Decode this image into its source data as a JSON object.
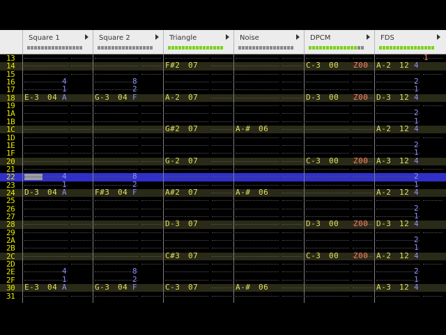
{
  "channels": [
    {
      "name": "Square 1",
      "meter_on": 0
    },
    {
      "name": "Square 2",
      "meter_on": 0
    },
    {
      "name": "Triangle",
      "meter_on": 16
    },
    {
      "name": "Noise",
      "meter_on": 0
    },
    {
      "name": "DPCM",
      "meter_on": 14
    },
    {
      "name": "FDS",
      "meter_on": 16
    }
  ],
  "rows": [
    {
      "n": "13",
      "cells": [
        [
          "",
          "",
          "",
          ""
        ],
        [
          "",
          "",
          "",
          ""
        ],
        [
          "",
          "",
          "",
          ""
        ],
        [
          "",
          "",
          "",
          ""
        ],
        [
          "",
          "",
          "",
          ""
        ],
        [
          "",
          "",
          "",
          "1"
        ]
      ]
    },
    {
      "n": "14",
      "hl": true,
      "cells": [
        [
          "",
          "",
          "",
          ""
        ],
        [
          "",
          "",
          "",
          ""
        ],
        [
          "F#2",
          "07",
          "",
          ""
        ],
        [
          "",
          "",
          "",
          ""
        ],
        [
          "C-3",
          "00",
          "",
          "Z00"
        ],
        [
          "A-2",
          "12",
          "4",
          ""
        ]
      ]
    },
    {
      "n": "15",
      "cells": [
        [
          "",
          "",
          "",
          ""
        ],
        [
          "",
          "",
          "",
          ""
        ],
        [
          "",
          "",
          "",
          ""
        ],
        [
          "",
          "",
          "",
          ""
        ],
        [
          "",
          "",
          "",
          ""
        ],
        [
          "",
          "",
          "",
          ""
        ]
      ]
    },
    {
      "n": "16",
      "cells": [
        [
          "",
          "",
          "4",
          ""
        ],
        [
          "",
          "",
          "8",
          ""
        ],
        [
          "",
          "",
          "",
          ""
        ],
        [
          "",
          "",
          "",
          ""
        ],
        [
          "",
          "",
          "",
          ""
        ],
        [
          "",
          "",
          "2",
          ""
        ]
      ]
    },
    {
      "n": "17",
      "cells": [
        [
          "",
          "",
          "1",
          ""
        ],
        [
          "",
          "",
          "2",
          ""
        ],
        [
          "",
          "",
          "",
          ""
        ],
        [
          "",
          "",
          "",
          ""
        ],
        [
          "",
          "",
          "",
          ""
        ],
        [
          "",
          "",
          "1",
          ""
        ]
      ]
    },
    {
      "n": "18",
      "hl": true,
      "cells": [
        [
          "E-3",
          "04",
          "A",
          ""
        ],
        [
          "G-3",
          "04",
          "F",
          ""
        ],
        [
          "A-2",
          "07",
          "",
          ""
        ],
        [
          "",
          "",
          "",
          ""
        ],
        [
          "D-3",
          "00",
          "",
          "Z00"
        ],
        [
          "D-3",
          "12",
          "4",
          ""
        ]
      ]
    },
    {
      "n": "19",
      "cells": [
        [
          "",
          "",
          "",
          ""
        ],
        [
          "",
          "",
          "",
          ""
        ],
        [
          "",
          "",
          "",
          ""
        ],
        [
          "",
          "",
          "",
          ""
        ],
        [
          "",
          "",
          "",
          ""
        ],
        [
          "",
          "",
          "",
          ""
        ]
      ]
    },
    {
      "n": "1A",
      "cells": [
        [
          "",
          "",
          "",
          ""
        ],
        [
          "",
          "",
          "",
          ""
        ],
        [
          "",
          "",
          "",
          ""
        ],
        [
          "",
          "",
          "",
          ""
        ],
        [
          "",
          "",
          "",
          ""
        ],
        [
          "",
          "",
          "2",
          ""
        ]
      ]
    },
    {
      "n": "1B",
      "cells": [
        [
          "",
          "",
          "",
          ""
        ],
        [
          "",
          "",
          "",
          ""
        ],
        [
          "",
          "",
          "",
          ""
        ],
        [
          "",
          "",
          "",
          ""
        ],
        [
          "",
          "",
          "",
          ""
        ],
        [
          "",
          "",
          "1",
          ""
        ]
      ]
    },
    {
      "n": "1C",
      "hl": true,
      "cells": [
        [
          "",
          "",
          "",
          ""
        ],
        [
          "",
          "",
          "",
          ""
        ],
        [
          "G#2",
          "07",
          "",
          ""
        ],
        [
          "A-#",
          "06",
          "",
          ""
        ],
        [
          "",
          "",
          "",
          ""
        ],
        [
          "A-2",
          "12",
          "4",
          ""
        ]
      ]
    },
    {
      "n": "1D",
      "cells": [
        [
          "",
          "",
          "",
          ""
        ],
        [
          "",
          "",
          "",
          ""
        ],
        [
          "",
          "",
          "",
          ""
        ],
        [
          "",
          "",
          "",
          ""
        ],
        [
          "",
          "",
          "",
          ""
        ],
        [
          "",
          "",
          "",
          ""
        ]
      ]
    },
    {
      "n": "1E",
      "cells": [
        [
          "",
          "",
          "",
          ""
        ],
        [
          "",
          "",
          "",
          ""
        ],
        [
          "",
          "",
          "",
          ""
        ],
        [
          "",
          "",
          "",
          ""
        ],
        [
          "",
          "",
          "",
          ""
        ],
        [
          "",
          "",
          "2",
          ""
        ]
      ]
    },
    {
      "n": "1F",
      "cells": [
        [
          "",
          "",
          "",
          ""
        ],
        [
          "",
          "",
          "",
          ""
        ],
        [
          "",
          "",
          "",
          ""
        ],
        [
          "",
          "",
          "",
          ""
        ],
        [
          "",
          "",
          "",
          ""
        ],
        [
          "",
          "",
          "1",
          ""
        ]
      ]
    },
    {
      "n": "20",
      "hl": true,
      "cells": [
        [
          "",
          "",
          "",
          ""
        ],
        [
          "",
          "",
          "",
          ""
        ],
        [
          "G-2",
          "07",
          "",
          ""
        ],
        [
          "",
          "",
          "",
          ""
        ],
        [
          "C-3",
          "00",
          "",
          "Z00"
        ],
        [
          "A-3",
          "12",
          "4",
          ""
        ]
      ]
    },
    {
      "n": "21",
      "cells": [
        [
          "",
          "",
          "",
          ""
        ],
        [
          "",
          "",
          "",
          ""
        ],
        [
          "",
          "",
          "",
          ""
        ],
        [
          "",
          "",
          "",
          ""
        ],
        [
          "",
          "",
          "",
          ""
        ],
        [
          "",
          "",
          "",
          ""
        ]
      ]
    },
    {
      "n": "22",
      "cur": true,
      "cells": [
        [
          "",
          "",
          "4",
          ""
        ],
        [
          "",
          "",
          "8",
          ""
        ],
        [
          "",
          "",
          "",
          ""
        ],
        [
          "",
          "",
          "",
          ""
        ],
        [
          "",
          "",
          "",
          ""
        ],
        [
          "",
          "",
          "2",
          ""
        ]
      ]
    },
    {
      "n": "23",
      "cells": [
        [
          "",
          "",
          "1",
          ""
        ],
        [
          "",
          "",
          "2",
          ""
        ],
        [
          "",
          "",
          "",
          ""
        ],
        [
          "",
          "",
          "",
          ""
        ],
        [
          "",
          "",
          "",
          ""
        ],
        [
          "",
          "",
          "1",
          ""
        ]
      ]
    },
    {
      "n": "24",
      "hl": true,
      "cells": [
        [
          "D-3",
          "04",
          "A",
          ""
        ],
        [
          "F#3",
          "04",
          "F",
          ""
        ],
        [
          "A#2",
          "07",
          "",
          ""
        ],
        [
          "A-#",
          "06",
          "",
          ""
        ],
        [
          "",
          "",
          "",
          ""
        ],
        [
          "A-2",
          "12",
          "4",
          ""
        ]
      ]
    },
    {
      "n": "25",
      "cells": [
        [
          "",
          "",
          "",
          ""
        ],
        [
          "",
          "",
          "",
          ""
        ],
        [
          "",
          "",
          "",
          ""
        ],
        [
          "",
          "",
          "",
          ""
        ],
        [
          "",
          "",
          "",
          ""
        ],
        [
          "",
          "",
          "",
          ""
        ]
      ]
    },
    {
      "n": "26",
      "cells": [
        [
          "",
          "",
          "",
          ""
        ],
        [
          "",
          "",
          "",
          ""
        ],
        [
          "",
          "",
          "",
          ""
        ],
        [
          "",
          "",
          "",
          ""
        ],
        [
          "",
          "",
          "",
          ""
        ],
        [
          "",
          "",
          "2",
          ""
        ]
      ]
    },
    {
      "n": "27",
      "cells": [
        [
          "",
          "",
          "",
          ""
        ],
        [
          "",
          "",
          "",
          ""
        ],
        [
          "",
          "",
          "",
          ""
        ],
        [
          "",
          "",
          "",
          ""
        ],
        [
          "",
          "",
          "",
          ""
        ],
        [
          "",
          "",
          "1",
          ""
        ]
      ]
    },
    {
      "n": "28",
      "hl": true,
      "cells": [
        [
          "",
          "",
          "",
          ""
        ],
        [
          "",
          "",
          "",
          ""
        ],
        [
          "D-3",
          "07",
          "",
          ""
        ],
        [
          "",
          "",
          "",
          ""
        ],
        [
          "D-3",
          "00",
          "",
          "Z00"
        ],
        [
          "D-3",
          "12",
          "4",
          ""
        ]
      ]
    },
    {
      "n": "29",
      "cells": [
        [
          "",
          "",
          "",
          ""
        ],
        [
          "",
          "",
          "",
          ""
        ],
        [
          "",
          "",
          "",
          ""
        ],
        [
          "",
          "",
          "",
          ""
        ],
        [
          "",
          "",
          "",
          ""
        ],
        [
          "",
          "",
          "",
          ""
        ]
      ]
    },
    {
      "n": "2A",
      "cells": [
        [
          "",
          "",
          "",
          ""
        ],
        [
          "",
          "",
          "",
          ""
        ],
        [
          "",
          "",
          "",
          ""
        ],
        [
          "",
          "",
          "",
          ""
        ],
        [
          "",
          "",
          "",
          ""
        ],
        [
          "",
          "",
          "2",
          ""
        ]
      ]
    },
    {
      "n": "2B",
      "cells": [
        [
          "",
          "",
          "",
          ""
        ],
        [
          "",
          "",
          "",
          ""
        ],
        [
          "",
          "",
          "",
          ""
        ],
        [
          "",
          "",
          "",
          ""
        ],
        [
          "",
          "",
          "",
          ""
        ],
        [
          "",
          "",
          "1",
          ""
        ]
      ]
    },
    {
      "n": "2C",
      "hl": true,
      "cells": [
        [
          "",
          "",
          "",
          ""
        ],
        [
          "",
          "",
          "",
          ""
        ],
        [
          "C#3",
          "07",
          "",
          ""
        ],
        [
          "",
          "",
          "",
          ""
        ],
        [
          "C-3",
          "00",
          "",
          "Z00"
        ],
        [
          "A-2",
          "12",
          "4",
          ""
        ]
      ]
    },
    {
      "n": "2D",
      "cells": [
        [
          "",
          "",
          "",
          ""
        ],
        [
          "",
          "",
          "",
          ""
        ],
        [
          "",
          "",
          "",
          ""
        ],
        [
          "",
          "",
          "",
          ""
        ],
        [
          "",
          "",
          "",
          ""
        ],
        [
          "",
          "",
          "",
          ""
        ]
      ]
    },
    {
      "n": "2E",
      "cells": [
        [
          "",
          "",
          "4",
          ""
        ],
        [
          "",
          "",
          "8",
          ""
        ],
        [
          "",
          "",
          "",
          ""
        ],
        [
          "",
          "",
          "",
          ""
        ],
        [
          "",
          "",
          "",
          ""
        ],
        [
          "",
          "",
          "2",
          ""
        ]
      ]
    },
    {
      "n": "2F",
      "cells": [
        [
          "",
          "",
          "1",
          ""
        ],
        [
          "",
          "",
          "2",
          ""
        ],
        [
          "",
          "",
          "",
          ""
        ],
        [
          "",
          "",
          "",
          ""
        ],
        [
          "",
          "",
          "",
          ""
        ],
        [
          "",
          "",
          "1",
          ""
        ]
      ]
    },
    {
      "n": "30",
      "hl": true,
      "cells": [
        [
          "E-3",
          "04",
          "A",
          ""
        ],
        [
          "G-3",
          "04",
          "F",
          ""
        ],
        [
          "C-3",
          "07",
          "",
          ""
        ],
        [
          "A-#",
          "06",
          "",
          ""
        ],
        [
          "",
          "",
          "",
          ""
        ],
        [
          "A-3",
          "12",
          "4",
          ""
        ]
      ]
    },
    {
      "n": "31",
      "cells": [
        [
          "",
          "",
          "",
          ""
        ],
        [
          "",
          "",
          "",
          ""
        ],
        [
          "",
          "",
          "",
          ""
        ],
        [
          "",
          "",
          "",
          ""
        ],
        [
          "",
          "",
          "",
          ""
        ],
        [
          "",
          "",
          "",
          ""
        ]
      ]
    }
  ]
}
